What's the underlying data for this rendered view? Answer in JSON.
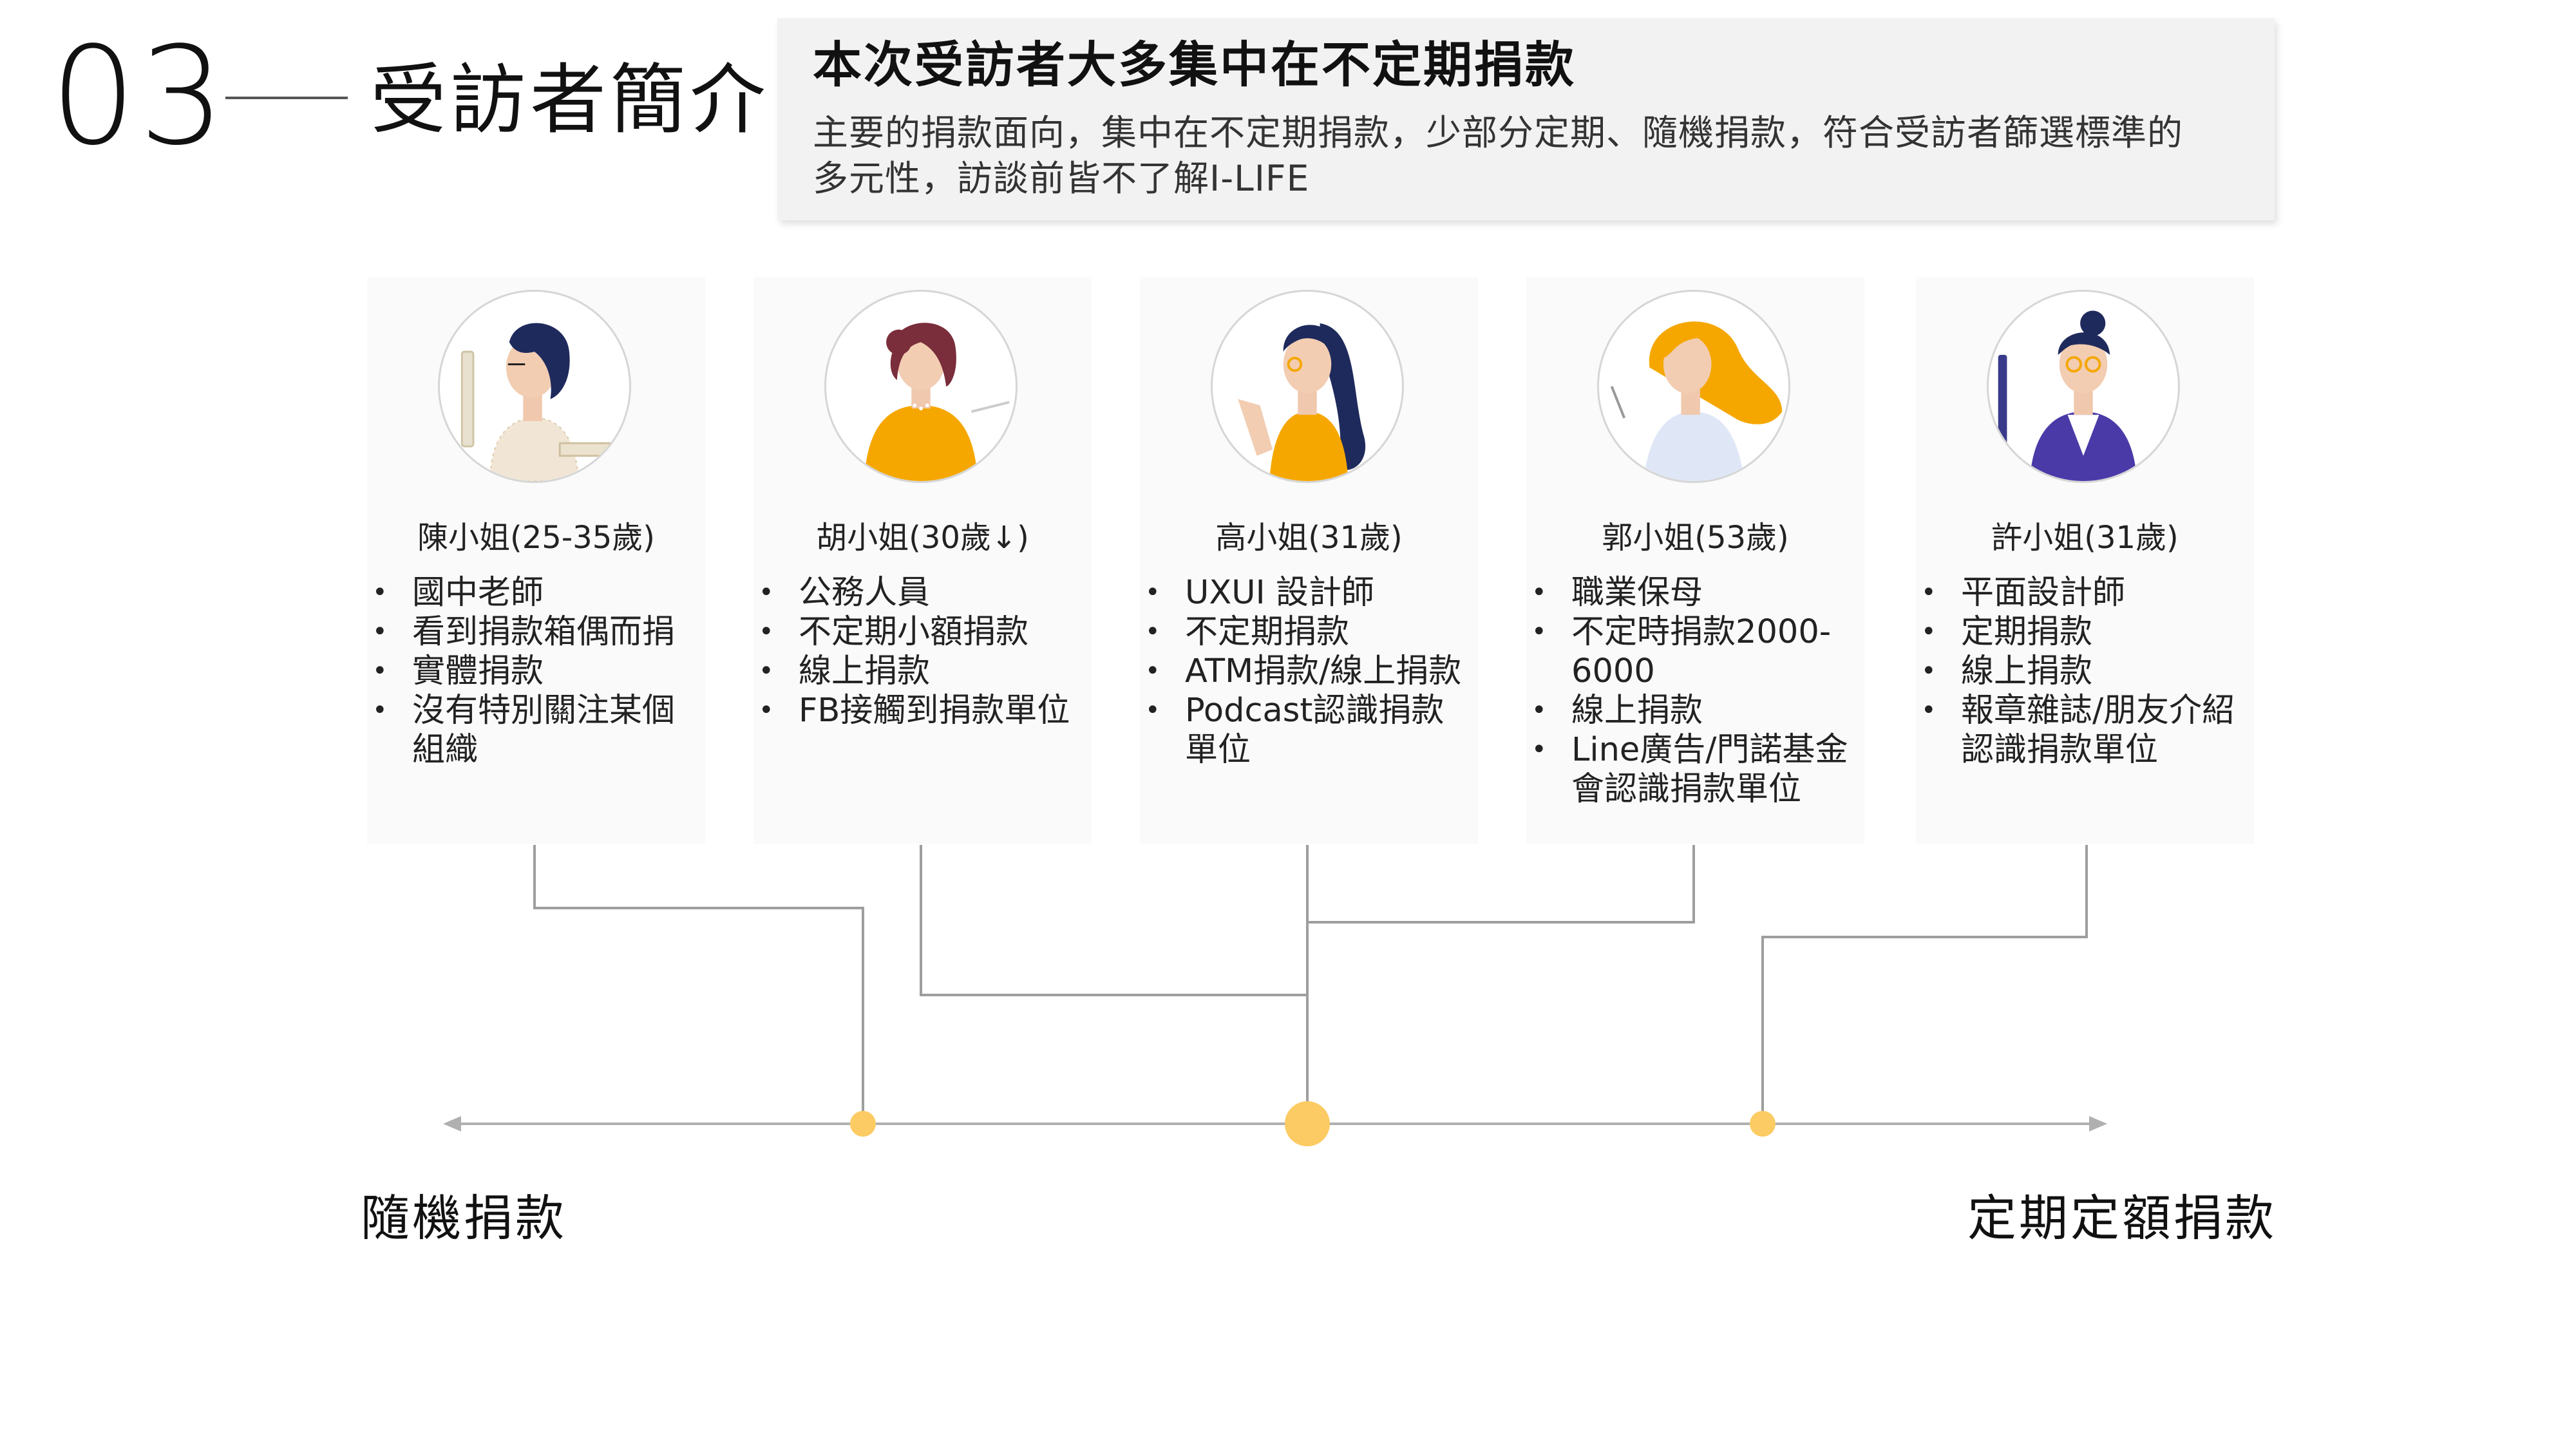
{
  "header": {
    "section_number": "03",
    "section_title": "受訪者簡介"
  },
  "summary": {
    "heading": "本次受訪者大多集中在不定期捐款",
    "body": "主要的捐款面向，集中在不定期捐款，少部分定期、隨機捐款，符合受訪者篩選標準的多元性，訪談前皆不了解I-LIFE"
  },
  "colors": {
    "accent_yellow": "#F5A700",
    "timeline_dot": "#FCCB63",
    "navy": "#1F2A5C",
    "purple": "#4A3AA8",
    "line_gray": "#9E9E9E"
  },
  "personas": [
    {
      "name": "陳小姐(25-35歲)",
      "items": [
        "國中老師",
        "看到捐款箱偶而捐",
        "實體捐款",
        "沒有特別關注某個組織"
      ]
    },
    {
      "name": "胡小姐(30歲↓)",
      "items": [
        "公務人員",
        "不定期小額捐款",
        "線上捐款",
        "FB接觸到捐款單位"
      ]
    },
    {
      "name": "高小姐(31歲)",
      "items": [
        "UXUI 設計師",
        "不定期捐款",
        "ATM捐款/線上捐款",
        "Podcast認識捐款單位"
      ]
    },
    {
      "name": "郭小姐(53歲)",
      "items": [
        "職業保母",
        "不定時捐款2000-6000",
        "線上捐款",
        "Line廣告/門諾基金會認識捐款單位"
      ]
    },
    {
      "name": "許小姐(31歲)",
      "items": [
        "平面設計師",
        "定期捐款",
        "線上捐款",
        "報章雜誌/朋友介紹認識捐款單位"
      ]
    }
  ],
  "timeline": {
    "left_label": "隨機捐款",
    "right_label": "定期定額捐款"
  }
}
